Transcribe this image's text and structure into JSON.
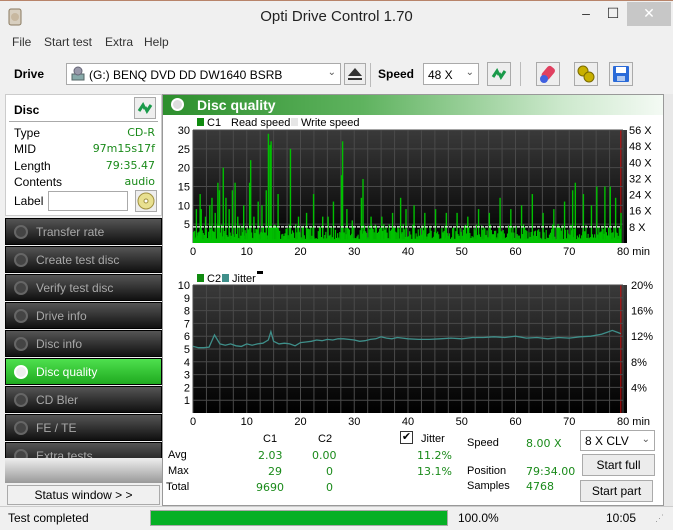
{
  "window": {
    "title": "Opti Drive Control 1.70",
    "min_label": "‒",
    "max_label": "☐",
    "close_label": "✕"
  },
  "menu": [
    "File",
    "Start test",
    "Extra",
    "Help"
  ],
  "toolbar": {
    "drive_label": "Drive",
    "drive_value": "(G:)  BENQ DVD DD DW1640 BSRB",
    "speed_label": "Speed",
    "speed_value": "48 X",
    "icons": [
      "eject-icon",
      "refresh-icon",
      "erase-icon",
      "settings-icon",
      "save-icon"
    ]
  },
  "disc": {
    "header": "Disc",
    "fields": [
      {
        "key": "Type",
        "value": "CD-R"
      },
      {
        "key": "MID",
        "value": "97m15s17f"
      },
      {
        "key": "Length",
        "value": "79:35.47"
      },
      {
        "key": "Contents",
        "value": "audio"
      }
    ],
    "label_key": "Label",
    "label_value": ""
  },
  "nav": [
    {
      "label": "Transfer rate",
      "active": false
    },
    {
      "label": "Create test disc",
      "active": false
    },
    {
      "label": "Verify test disc",
      "active": false
    },
    {
      "label": "Drive info",
      "active": false
    },
    {
      "label": "Disc info",
      "active": false
    },
    {
      "label": "Disc quality",
      "active": true
    },
    {
      "label": "CD Bler",
      "active": false
    },
    {
      "label": "FE / TE",
      "active": false
    },
    {
      "label": "Extra tests",
      "active": false
    }
  ],
  "status_window_label": "Status window > >",
  "main": {
    "title": "Disc quality"
  },
  "colors": {
    "c1": "#00c000",
    "jitter": "#3f8f8a",
    "speed_line": "#ffffff",
    "marker": "#d01010",
    "accent": "#2d8f2d"
  },
  "chart_data": [
    {
      "type": "bar",
      "title": "C1",
      "legend": [
        "C1",
        "Read speed",
        "Write speed"
      ],
      "xlabel": "min",
      "xlim": [
        0,
        80
      ],
      "x_ticks": [
        "0",
        "10",
        "20",
        "30",
        "40",
        "50",
        "60",
        "70",
        "80 min"
      ],
      "ylim": [
        0,
        30
      ],
      "y_ticks": [
        "5",
        "10",
        "15",
        "20",
        "25",
        "30"
      ],
      "y2_ticks": [
        "8 X",
        "16 X",
        "24 X",
        "32 X",
        "40 X",
        "48 X",
        "56 X"
      ],
      "y2lim": [
        0,
        56
      ],
      "read_speed_x": 8,
      "peaks": [
        {
          "x": 0.5,
          "y": 9
        },
        {
          "x": 1.2,
          "y": 13
        },
        {
          "x": 1.4,
          "y": 9
        },
        {
          "x": 2.2,
          "y": 7
        },
        {
          "x": 3,
          "y": 10
        },
        {
          "x": 3.4,
          "y": 12
        },
        {
          "x": 4,
          "y": 8
        },
        {
          "x": 4.5,
          "y": 16
        },
        {
          "x": 4.8,
          "y": 14
        },
        {
          "x": 5.5,
          "y": 20
        },
        {
          "x": 6,
          "y": 12
        },
        {
          "x": 6.6,
          "y": 9
        },
        {
          "x": 7.2,
          "y": 14
        },
        {
          "x": 7.7,
          "y": 16
        },
        {
          "x": 8.2,
          "y": 7
        },
        {
          "x": 9.3,
          "y": 10
        },
        {
          "x": 10.4,
          "y": 16
        },
        {
          "x": 10.6,
          "y": 22
        },
        {
          "x": 11.2,
          "y": 7
        },
        {
          "x": 12,
          "y": 11
        },
        {
          "x": 12.7,
          "y": 10
        },
        {
          "x": 13.5,
          "y": 14
        },
        {
          "x": 13.9,
          "y": 29
        },
        {
          "x": 14.2,
          "y": 26
        },
        {
          "x": 14.4,
          "y": 27
        },
        {
          "x": 15.7,
          "y": 13
        },
        {
          "x": 18,
          "y": 25
        },
        {
          "x": 19.5,
          "y": 7
        },
        {
          "x": 21,
          "y": 8
        },
        {
          "x": 22.3,
          "y": 13
        },
        {
          "x": 24,
          "y": 7
        },
        {
          "x": 25,
          "y": 7
        },
        {
          "x": 26,
          "y": 11
        },
        {
          "x": 27.5,
          "y": 18
        },
        {
          "x": 27.7,
          "y": 27
        },
        {
          "x": 28.5,
          "y": 9
        },
        {
          "x": 29.5,
          "y": 6
        },
        {
          "x": 31.2,
          "y": 12
        },
        {
          "x": 31.5,
          "y": 17
        },
        {
          "x": 33,
          "y": 7
        },
        {
          "x": 35,
          "y": 7
        },
        {
          "x": 37,
          "y": 8
        },
        {
          "x": 38.5,
          "y": 12
        },
        {
          "x": 39.5,
          "y": 9
        },
        {
          "x": 41,
          "y": 10
        },
        {
          "x": 43,
          "y": 8
        },
        {
          "x": 45,
          "y": 9
        },
        {
          "x": 47,
          "y": 8
        },
        {
          "x": 49,
          "y": 8
        },
        {
          "x": 51,
          "y": 7
        },
        {
          "x": 53,
          "y": 9
        },
        {
          "x": 55,
          "y": 8
        },
        {
          "x": 57,
          "y": 12
        },
        {
          "x": 59,
          "y": 9
        },
        {
          "x": 61,
          "y": 10
        },
        {
          "x": 63,
          "y": 13
        },
        {
          "x": 65,
          "y": 8
        },
        {
          "x": 67,
          "y": 9
        },
        {
          "x": 69,
          "y": 11
        },
        {
          "x": 70.5,
          "y": 14
        },
        {
          "x": 71,
          "y": 16
        },
        {
          "x": 72.5,
          "y": 13
        },
        {
          "x": 74,
          "y": 10
        },
        {
          "x": 75,
          "y": 15
        },
        {
          "x": 76.5,
          "y": 15
        },
        {
          "x": 77.5,
          "y": 15
        },
        {
          "x": 78.5,
          "y": 12
        },
        {
          "x": 79.5,
          "y": 8
        }
      ],
      "baseline_range": [
        1,
        5
      ]
    },
    {
      "type": "line",
      "title": "C2 / Jitter",
      "legend": [
        "C2",
        "Jitter"
      ],
      "xlabel": "min",
      "xlim": [
        0,
        80
      ],
      "x_ticks": [
        "0",
        "10",
        "20",
        "30",
        "40",
        "50",
        "60",
        "70",
        "80 min"
      ],
      "ylim": [
        0,
        10
      ],
      "y_ticks": [
        "1",
        "2",
        "3",
        "4",
        "5",
        "6",
        "7",
        "8",
        "9",
        "10"
      ],
      "y2lim": [
        0,
        20
      ],
      "y2_ticks": [
        "4%",
        "8%",
        "12%",
        "16%",
        "20%"
      ],
      "c2_values": "all 0",
      "jitter_percent": [
        [
          0,
          10.4
        ],
        [
          1,
          10.2
        ],
        [
          2,
          10.2
        ],
        [
          3,
          10.3
        ],
        [
          4,
          12.2
        ],
        [
          5,
          10.8
        ],
        [
          6,
          10.6
        ],
        [
          7,
          10.8
        ],
        [
          8,
          10.5
        ],
        [
          9,
          10.4
        ],
        [
          10,
          10.8
        ],
        [
          11,
          10.6
        ],
        [
          12,
          10.8
        ],
        [
          13,
          10.9
        ],
        [
          14,
          11.4
        ],
        [
          14.5,
          12.7
        ],
        [
          15,
          11.2
        ],
        [
          16,
          10.8
        ],
        [
          17,
          10.9
        ],
        [
          18,
          10.8
        ],
        [
          19,
          10.5
        ],
        [
          20,
          11.0
        ],
        [
          21,
          11.1
        ],
        [
          22,
          11.2
        ],
        [
          23,
          11.4
        ],
        [
          24,
          11.3
        ],
        [
          25,
          11.5
        ],
        [
          26,
          11.4
        ],
        [
          27,
          11.6
        ],
        [
          28,
          11.6
        ],
        [
          29,
          11.5
        ],
        [
          30,
          11.4
        ],
        [
          31,
          11.2
        ],
        [
          32,
          11.3
        ],
        [
          33,
          11.5
        ],
        [
          34,
          11.6
        ],
        [
          35,
          11.9
        ],
        [
          36,
          11.7
        ],
        [
          37,
          11.6
        ],
        [
          38,
          11.8
        ],
        [
          39,
          11.7
        ],
        [
          40,
          11.6
        ],
        [
          42,
          11.5
        ],
        [
          44,
          11.5
        ],
        [
          46,
          11.6
        ],
        [
          48,
          11.7
        ],
        [
          50,
          11.6
        ],
        [
          52,
          11.8
        ],
        [
          54,
          11.8
        ],
        [
          56,
          11.9
        ],
        [
          58,
          11.8
        ],
        [
          60,
          12.0
        ],
        [
          62,
          11.7
        ],
        [
          64,
          11.8
        ],
        [
          66,
          11.6
        ],
        [
          68,
          11.8
        ],
        [
          70,
          11.7
        ],
        [
          72,
          11.9
        ],
        [
          74,
          12.0
        ],
        [
          76,
          12.3
        ],
        [
          77,
          12.6
        ],
        [
          78,
          12.9
        ],
        [
          79,
          12.6
        ],
        [
          80,
          12.4
        ]
      ]
    }
  ],
  "stats": {
    "col_c1": "C1",
    "col_c2": "C2",
    "col_jitter": "Jitter",
    "jitter_checked": true,
    "rows": [
      {
        "label": "Avg",
        "c1": "2.03",
        "c2": "0.00",
        "jitter": "11.2%"
      },
      {
        "label": "Max",
        "c1": "29",
        "c2": "0",
        "jitter": "13.1%"
      },
      {
        "label": "Total",
        "c1": "9690",
        "c2": "0",
        "jitter": ""
      }
    ],
    "speed_label": "Speed",
    "speed_value": "8.00 X",
    "position_label": "Position",
    "position_value": "79:34.00",
    "samples_label": "Samples",
    "samples_value": "4768",
    "mode_value": "8 X CLV",
    "start_full": "Start full",
    "start_part": "Start part"
  },
  "statusbar": {
    "text": "Test completed",
    "progress": 100.0,
    "progress_text": "100.0%",
    "time": "10:05"
  }
}
